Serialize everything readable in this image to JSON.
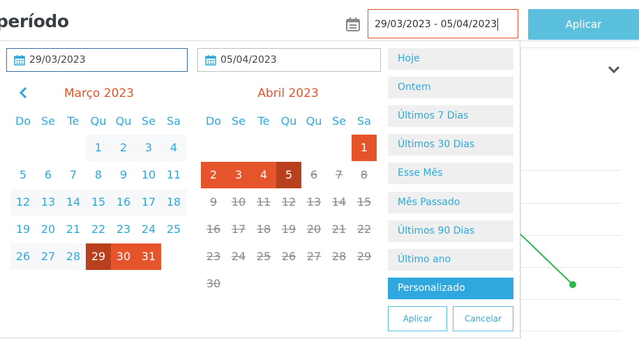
{
  "header": {
    "title": "período",
    "range_value": "29/03/2023 - 05/04/2023",
    "apply_label": "Aplicar"
  },
  "picker": {
    "start_input": "29/03/2023",
    "end_input": "05/04/2023",
    "left_month": "Março 2023",
    "right_month": "Abril 2023",
    "weekdays": [
      "Do",
      "Se",
      "Te",
      "Qu",
      "Qu",
      "Se",
      "Sa"
    ],
    "left_rows": [
      [
        "",
        "",
        "",
        "1",
        "2",
        "3",
        "4"
      ],
      [
        "5",
        "6",
        "7",
        "8",
        "9",
        "10",
        "11"
      ],
      [
        "12",
        "13",
        "14",
        "15",
        "16",
        "17",
        "18"
      ],
      [
        "19",
        "20",
        "21",
        "22",
        "23",
        "24",
        "25"
      ],
      [
        "26",
        "27",
        "28",
        "29",
        "30",
        "31",
        ""
      ]
    ],
    "right_rows": [
      [
        "",
        "",
        "",
        "",
        "",
        "",
        "1"
      ],
      [
        "2",
        "3",
        "4",
        "5",
        "6",
        "7",
        "8"
      ],
      [
        "9",
        "10",
        "11",
        "12",
        "13",
        "14",
        "15"
      ],
      [
        "16",
        "17",
        "18",
        "19",
        "20",
        "21",
        "22"
      ],
      [
        "23",
        "24",
        "25",
        "26",
        "27",
        "28",
        "29"
      ],
      [
        "30",
        "",
        "",
        "",
        "",
        "",
        ""
      ]
    ],
    "ranges": [
      "Hoje",
      "Ontem",
      "Últimos 7 Dias",
      "Últimos 30 Dias",
      "Esse Mês",
      "Mês Passado",
      "Últimos 90 Dias",
      "Último ano",
      "Personalizado"
    ],
    "active_range": "Personalizado",
    "apply_label": "Aplicar",
    "cancel_label": "Cancelar"
  },
  "colors": {
    "accent": "#e5542b",
    "accent_dark": "#b8401f",
    "link": "#2fa8d8",
    "button": "#5bc0de",
    "chart_line": "#2db84d"
  }
}
